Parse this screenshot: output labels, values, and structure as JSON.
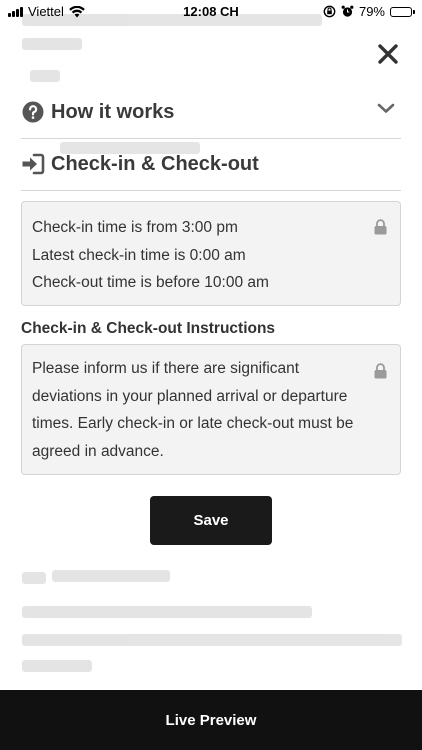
{
  "status_bar": {
    "carrier": "Viettel",
    "time": "12:08 CH",
    "battery": "79%",
    "battery_level": 0.79
  },
  "sections": {
    "how_it_works": {
      "title": "How it works",
      "icon": "question-circle-icon"
    },
    "check_in_out": {
      "title": "Check-in & Check-out",
      "icon": "sign-in-icon"
    }
  },
  "check_times": {
    "lines": [
      "Check-in time is from 3:00 pm",
      "Latest check-in time is 0:00 am",
      "Check-out time is before 10:00 am"
    ]
  },
  "instructions": {
    "heading": "Check-in & Check-out Instructions",
    "text": "Please inform us if there are significant deviations in your planned arrival or departure times. Early check-in or late check-out must be agreed in advance."
  },
  "buttons": {
    "save": "Save",
    "live_preview": "Live Preview"
  },
  "colors": {
    "primary_button": "#1a1a1a",
    "bottom_bar": "#111111",
    "field_background": "#f3f3f3"
  }
}
